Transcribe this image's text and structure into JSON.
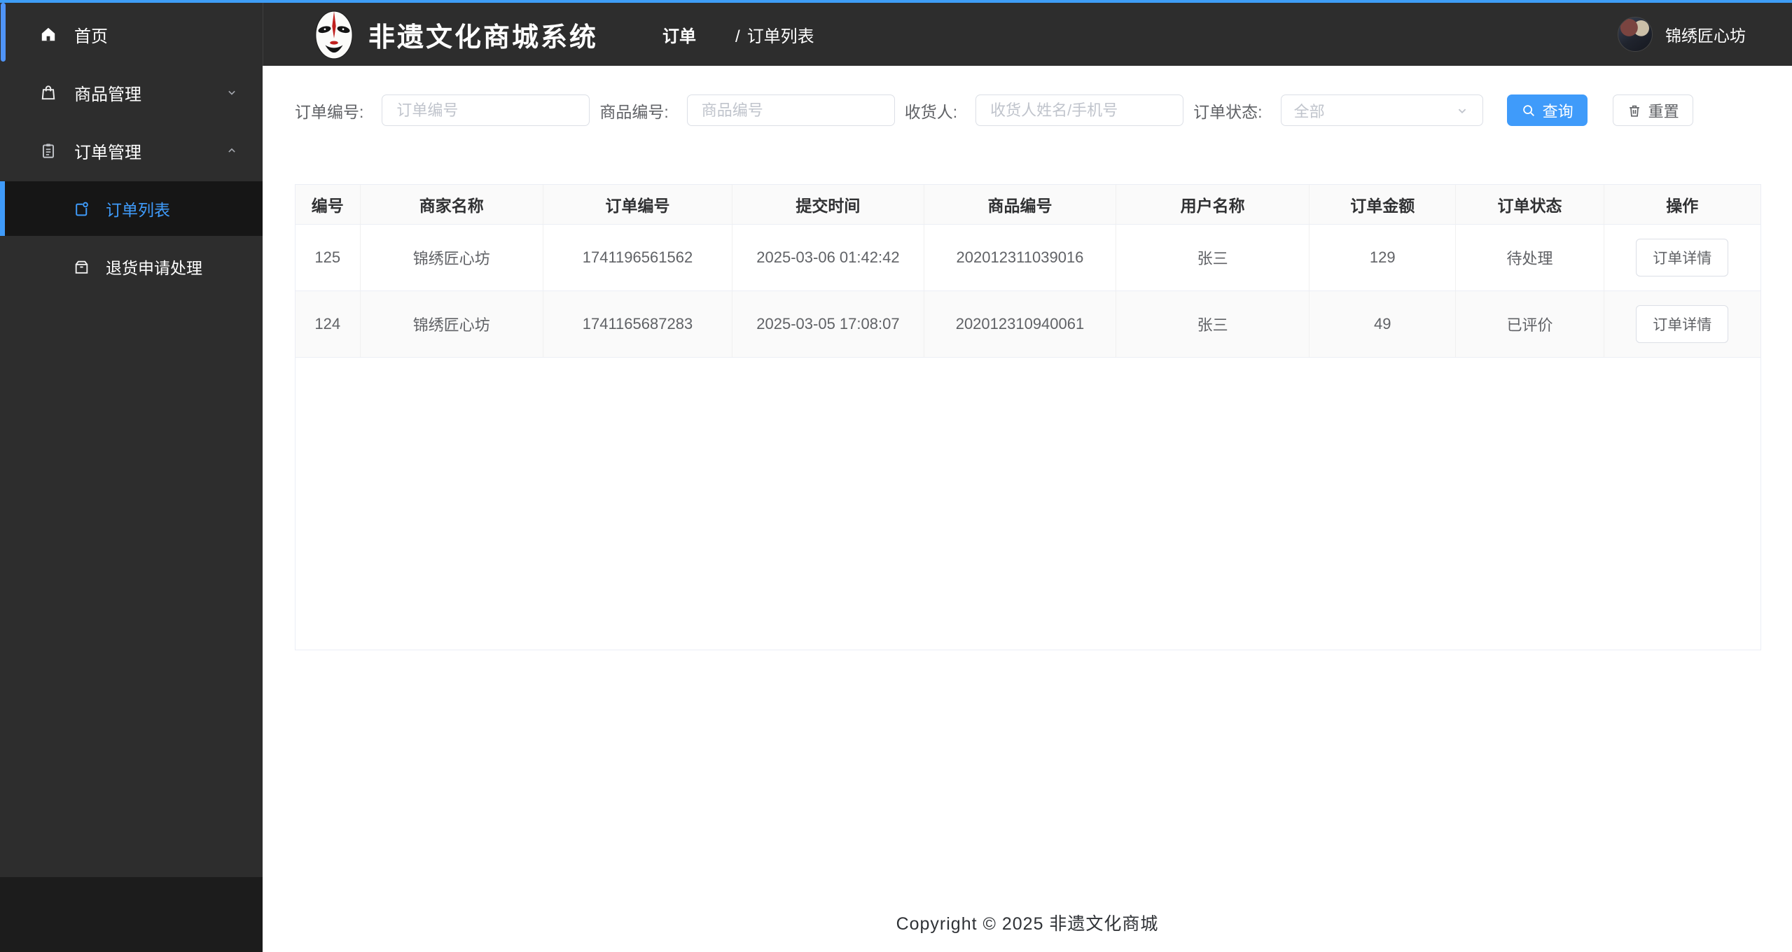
{
  "colors": {
    "accent": "#3f9bfa",
    "sidebar_bg": "#2d2d2d",
    "active_item_bg": "#161616"
  },
  "header": {
    "title": "非遗文化商城系统",
    "breadcrumb": {
      "section": "订单",
      "separator": "/",
      "page": "订单列表"
    },
    "user": {
      "name": "锦绣匠心坊"
    }
  },
  "sidebar": {
    "items": [
      {
        "label": "首页"
      },
      {
        "label": "商品管理"
      },
      {
        "label": "订单管理"
      }
    ],
    "sub_items": [
      {
        "label": "订单列表"
      },
      {
        "label": "退货申请处理"
      }
    ]
  },
  "filters": {
    "fields": [
      {
        "label": "订单编号:",
        "placeholder": "订单编号"
      },
      {
        "label": "商品编号:",
        "placeholder": "商品编号"
      },
      {
        "label": "收货人:",
        "placeholder": "收货人姓名/手机号"
      },
      {
        "label": "订单状态:",
        "value": "全部"
      }
    ],
    "search_label": "查询",
    "reset_label": "重置"
  },
  "table": {
    "columns": [
      "编号",
      "商家名称",
      "订单编号",
      "提交时间",
      "商品编号",
      "用户名称",
      "订单金额",
      "订单状态",
      "操作"
    ],
    "action_label": "订单详情",
    "rows": [
      {
        "id": "125",
        "merchant": "锦绣匠心坊",
        "order_no": "1741196561562",
        "submit_time": "2025-03-06 01:42:42",
        "product_no": "202012311039016",
        "user": "张三",
        "amount": "129",
        "status": "待处理"
      },
      {
        "id": "124",
        "merchant": "锦绣匠心坊",
        "order_no": "1741165687283",
        "submit_time": "2025-03-05 17:08:07",
        "product_no": "202012310940061",
        "user": "张三",
        "amount": "49",
        "status": "已评价"
      }
    ]
  },
  "footer": {
    "copyright": "Copyright ©  2025   非遗文化商城"
  }
}
